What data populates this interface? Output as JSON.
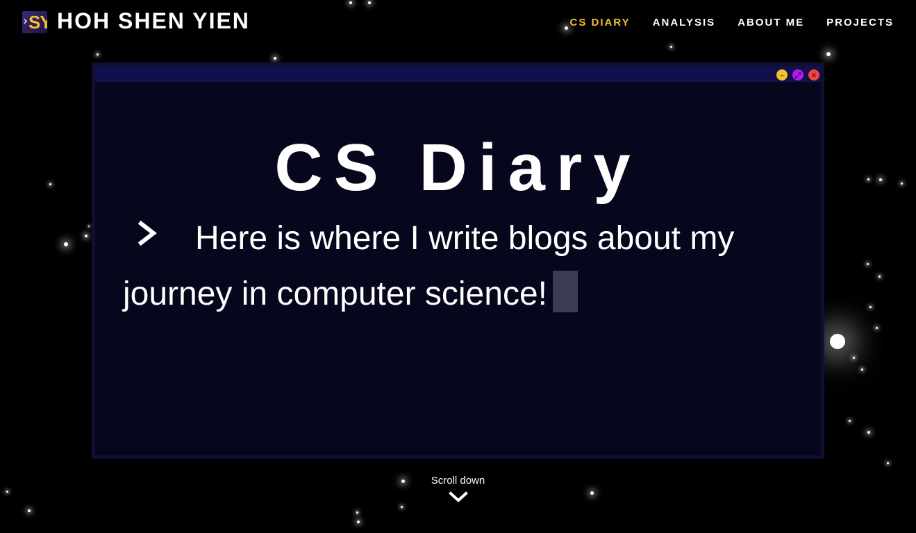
{
  "header": {
    "logo_text": "SY",
    "brand": "HOH SHEN YIEN",
    "nav": [
      {
        "label": "CS DIARY",
        "active": true
      },
      {
        "label": "ANALYSIS",
        "active": false
      },
      {
        "label": "ABOUT ME",
        "active": false
      },
      {
        "label": "PROJECTS",
        "active": false
      }
    ]
  },
  "window": {
    "title": "CS Diary",
    "subtitle": "Here is where I write blogs about my journey in computer science!",
    "controls": [
      "minimize-icon",
      "maximize-icon",
      "close-icon"
    ]
  },
  "footer": {
    "scroll_label": "Scroll down",
    "scroll_icon": "chevron-down-icon"
  },
  "colors": {
    "accent": "#f2c12e",
    "background": "#000000",
    "window_bg": "#06061c",
    "titlebar": "#10104a",
    "minimize": "#f2c12e",
    "maximize": "#b21cf0",
    "close": "#f04545"
  }
}
